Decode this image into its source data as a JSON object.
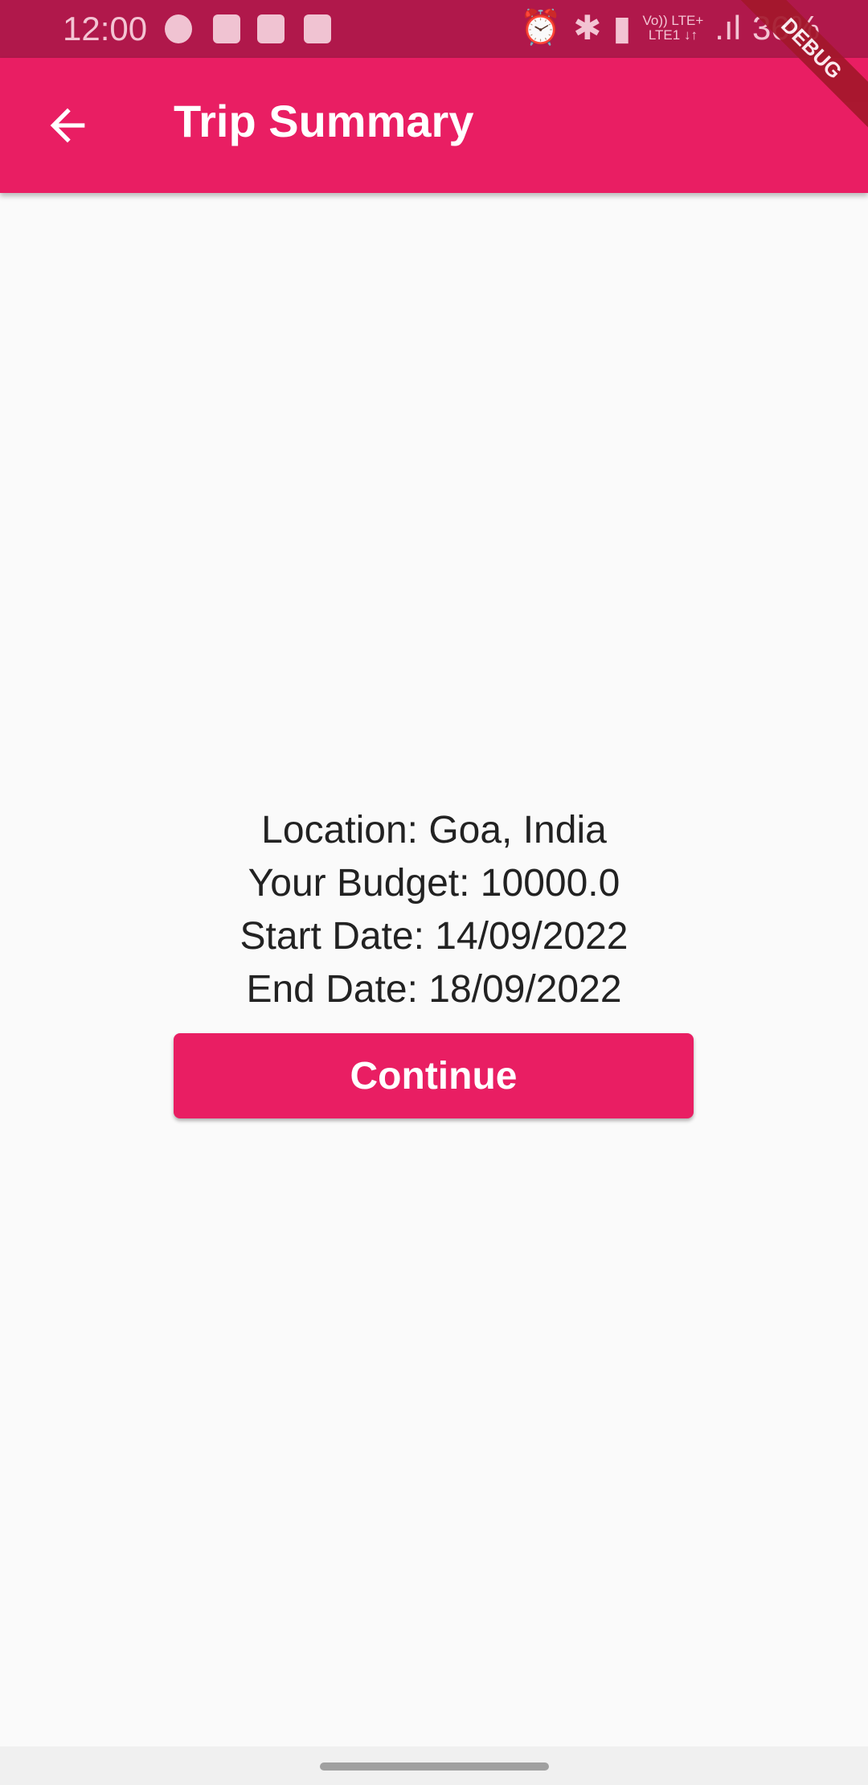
{
  "status_bar": {
    "time": "12:00",
    "battery": "36%",
    "network_top": "Vo)) LTE+",
    "network_bottom": "LTE1 ↓↑"
  },
  "app_bar": {
    "title": "Trip Summary",
    "debug_banner": "DEBUG"
  },
  "summary": {
    "location": "Location: Goa, India",
    "budget": "Your Budget: 10000.0",
    "start_date": "Start Date: 14/09/2022",
    "end_date": "End Date: 18/09/2022"
  },
  "continue_label": "Continue",
  "colors": {
    "primary": "#e91e63",
    "status_bar": "#b0184b"
  }
}
